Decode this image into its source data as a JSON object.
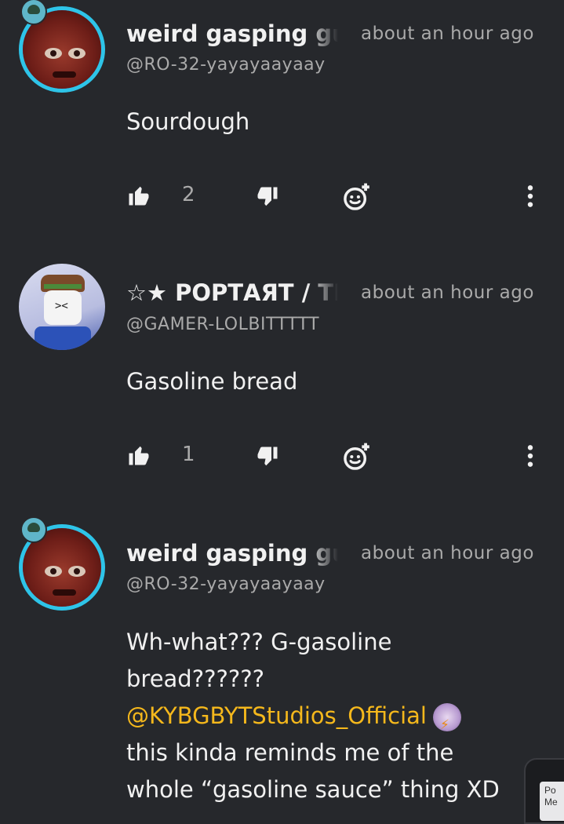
{
  "comments": [
    {
      "name": "weird gasping guy",
      "time": "about an hour ago",
      "handle": "@RO-32-yayayaayaay",
      "text": "Sourdough",
      "likes": "2"
    },
    {
      "name": "☆★ РОРТАЯТ / ТНЕ",
      "time": "about an hour ago",
      "handle": "@GAMER-LOLBITTTTT",
      "text": "Gasoline bread",
      "likes": "1"
    },
    {
      "name": "weird gasping guy",
      "time": "about an hour ago",
      "handle": "@RO-32-yayayaayaay",
      "text_line1": "Wh-what??? G-gasoline",
      "text_line2": "bread??????",
      "mention": "@KYBGBYTStudios_Official",
      "text_line4": "this kinda reminds me of the",
      "text_line5": "whole “gasoline sauce” thing XD"
    }
  ],
  "corner_card": {
    "text": "Po Me"
  },
  "icons": {
    "like": "thumb-up-icon",
    "dislike": "thumb-down-icon",
    "react": "add-emoji-icon",
    "more": "more-vertical-icon"
  }
}
